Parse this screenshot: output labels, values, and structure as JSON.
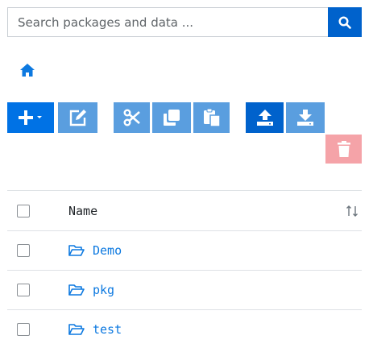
{
  "search": {
    "placeholder": "Search packages and data ...",
    "value": ""
  },
  "toolbar": {
    "buttons": [
      {
        "name": "add-button",
        "icon": "plus-caret-icon"
      },
      {
        "name": "edit-button",
        "icon": "edit-icon"
      },
      {
        "name": "cut-button",
        "icon": "scissors-icon"
      },
      {
        "name": "copy-button",
        "icon": "copy-icon"
      },
      {
        "name": "paste-button",
        "icon": "paste-icon"
      },
      {
        "name": "upload-button",
        "icon": "upload-icon"
      },
      {
        "name": "download-button",
        "icon": "download-icon"
      },
      {
        "name": "delete-button",
        "icon": "trash-icon"
      }
    ]
  },
  "table": {
    "header": {
      "name": "Name"
    },
    "rows": [
      {
        "name": "Demo"
      },
      {
        "name": "pkg"
      },
      {
        "name": "test"
      }
    ]
  },
  "colors": {
    "primary": "#0072e5",
    "primary_dark": "#0062cc",
    "muted": "#5a9edf",
    "danger_muted": "#f5a3a8",
    "link": "#0d79e0"
  }
}
